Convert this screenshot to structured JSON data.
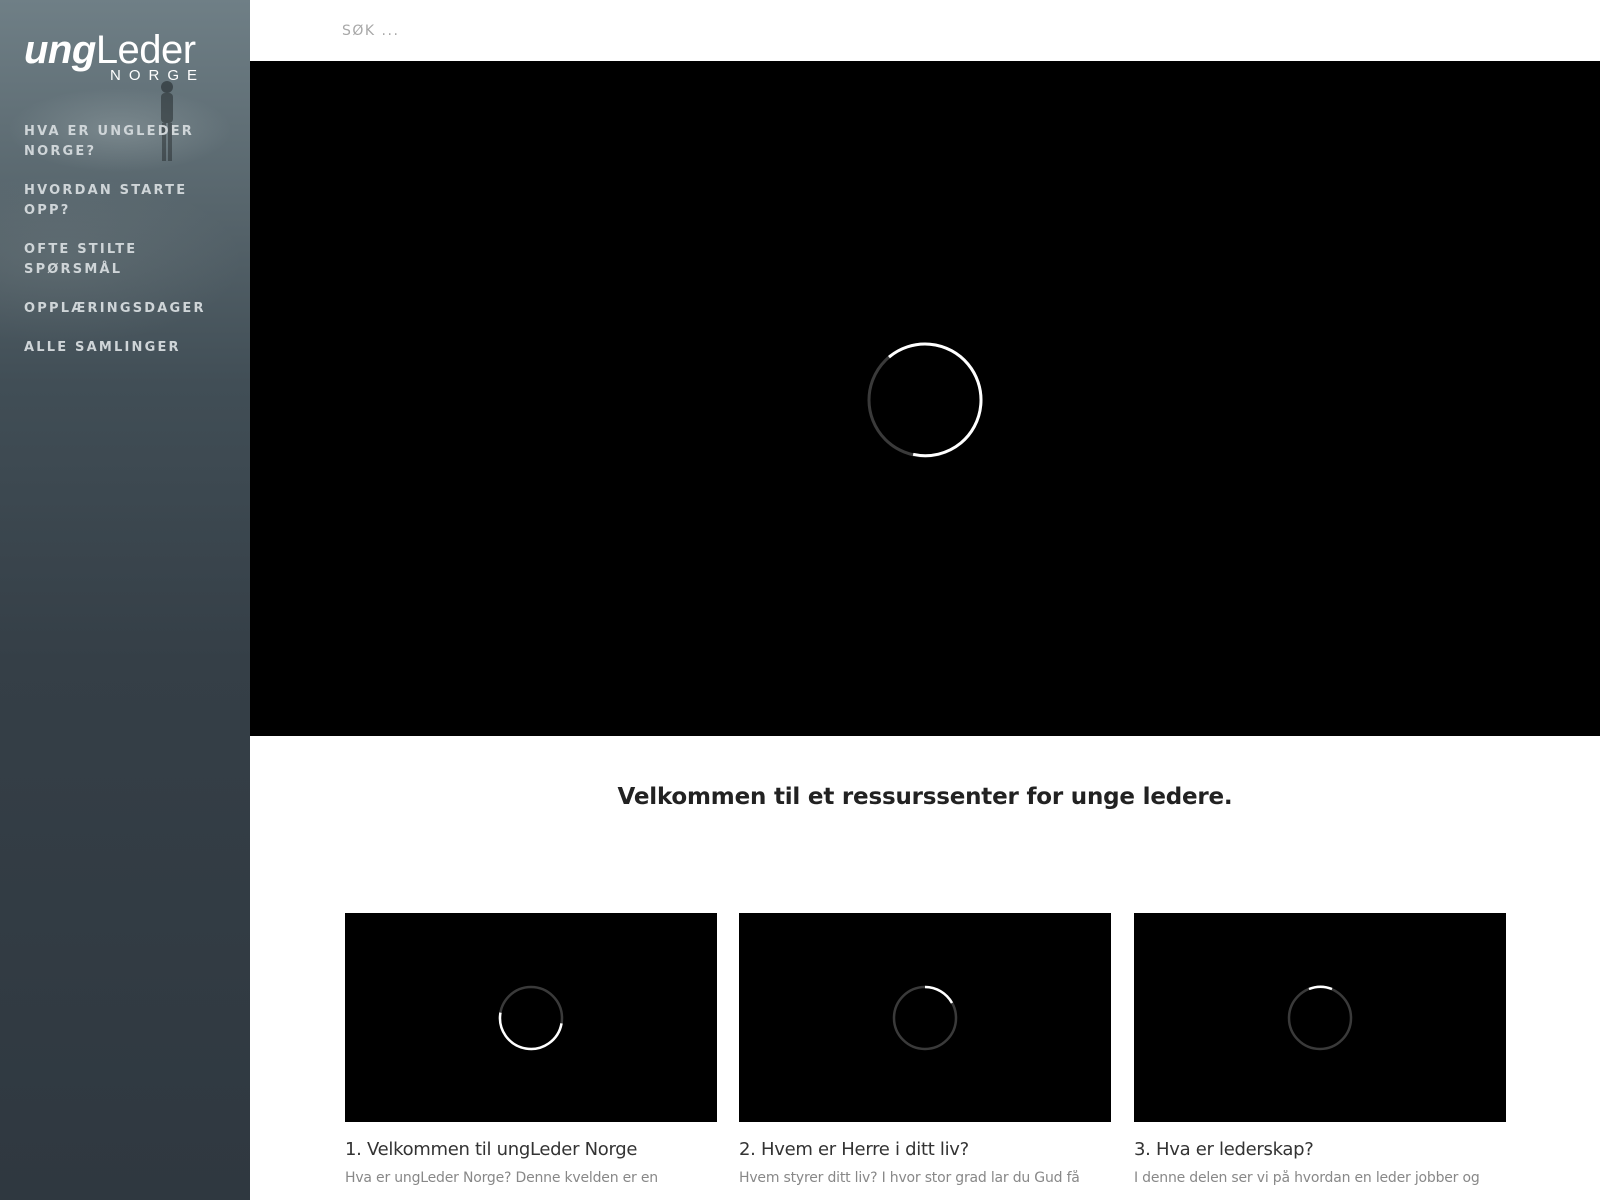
{
  "brand": {
    "logo_ung": "ung",
    "logo_leder": "Leder",
    "logo_norge": "NORGE"
  },
  "sidebar": {
    "items": [
      {
        "label": "HVA ER UNGLEDER NORGE?"
      },
      {
        "label": "HVORDAN STARTE OPP?"
      },
      {
        "label": "OFTE STILTE SPØRSMÅL"
      },
      {
        "label": "OPPLÆRINGSDAGER"
      },
      {
        "label": "ALLE SAMLINGER"
      }
    ]
  },
  "search": {
    "placeholder": "SØK ..."
  },
  "main": {
    "welcome": "Velkommen til et ressurssenter for unge ledere.",
    "cards": [
      {
        "title": "1. Velkommen til ungLeder Norge",
        "desc": "Hva er ungLeder Norge? Denne kvelden er en"
      },
      {
        "title": "2. Hvem er Herre i ditt liv?",
        "desc": "Hvem styrer ditt liv? I hvor stor grad lar du Gud få"
      },
      {
        "title": "3. Hva er lederskap?",
        "desc": "I denne delen ser vi på hvordan en leder jobber og"
      }
    ]
  },
  "colors": {
    "sidebar_top": "#6f7f86",
    "sidebar_bottom": "#2f3840",
    "video_bg": "#000000",
    "spinner": "#ffffff"
  }
}
